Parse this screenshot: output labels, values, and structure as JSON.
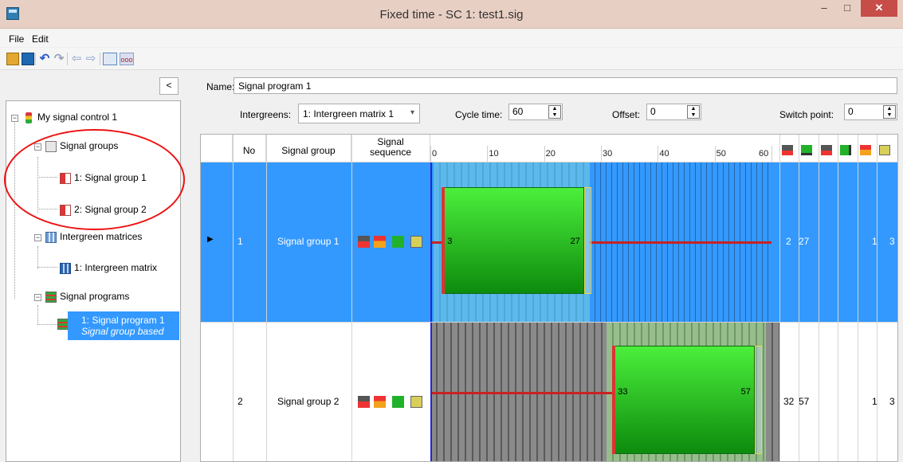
{
  "window": {
    "title": "Fixed time - SC 1: test1.sig",
    "minimize": "–",
    "maximize": "□",
    "close": "✕"
  },
  "menu": {
    "file": "File",
    "edit": "Edit"
  },
  "toolbar": {
    "undo": "↶",
    "redo": "↷",
    "back": "⇦",
    "forward": "⇨",
    "view": "ooo"
  },
  "panel": {
    "collapse_label": "<"
  },
  "tree": {
    "root": "My signal control 1",
    "signal_groups": "Signal groups",
    "sg1": "1: Signal group 1",
    "sg2": "2: Signal group 2",
    "intergreen_matrices": "Intergreen matrices",
    "matrix1": "1: Intergreen matrix",
    "signal_programs": "Signal programs",
    "program1": "1: Signal program 1",
    "program1_sub": "Signal group based"
  },
  "form": {
    "name_label": "Name:",
    "name_value": "Signal program 1",
    "intergreens_label": "Intergreens:",
    "intergreens_value": "1: Intergreen matrix 1",
    "cycle_label": "Cycle time:",
    "cycle_value": "60",
    "offset_label": "Offset:",
    "offset_value": "0",
    "switch_label": "Switch point:",
    "switch_value": "0"
  },
  "grid": {
    "headers": {
      "no": "No",
      "signal_group": "Signal group",
      "signal_sequence": "Signal\nsequence"
    },
    "timeline_ticks": [
      "0",
      "10",
      "20",
      "30",
      "40",
      "50",
      "60"
    ],
    "rows": [
      {
        "no": "1",
        "name": "Signal group 1",
        "start_label": "3",
        "end_label": "27",
        "c1": "2",
        "c2": "27",
        "c3": "1",
        "c4": "3",
        "green_start": 3,
        "green_end": 27
      },
      {
        "no": "2",
        "name": "Signal group 2",
        "start_label": "33",
        "end_label": "57",
        "c1": "32",
        "c2": "57",
        "c3": "1",
        "c4": "3",
        "green_start": 33,
        "green_end": 57
      }
    ]
  },
  "colors": {
    "selection": "#3399ff",
    "green_signal": "#22b22a",
    "red_signal": "#c92222",
    "amber_signal": "#e9d84a",
    "annotation_circle": "#e11"
  }
}
